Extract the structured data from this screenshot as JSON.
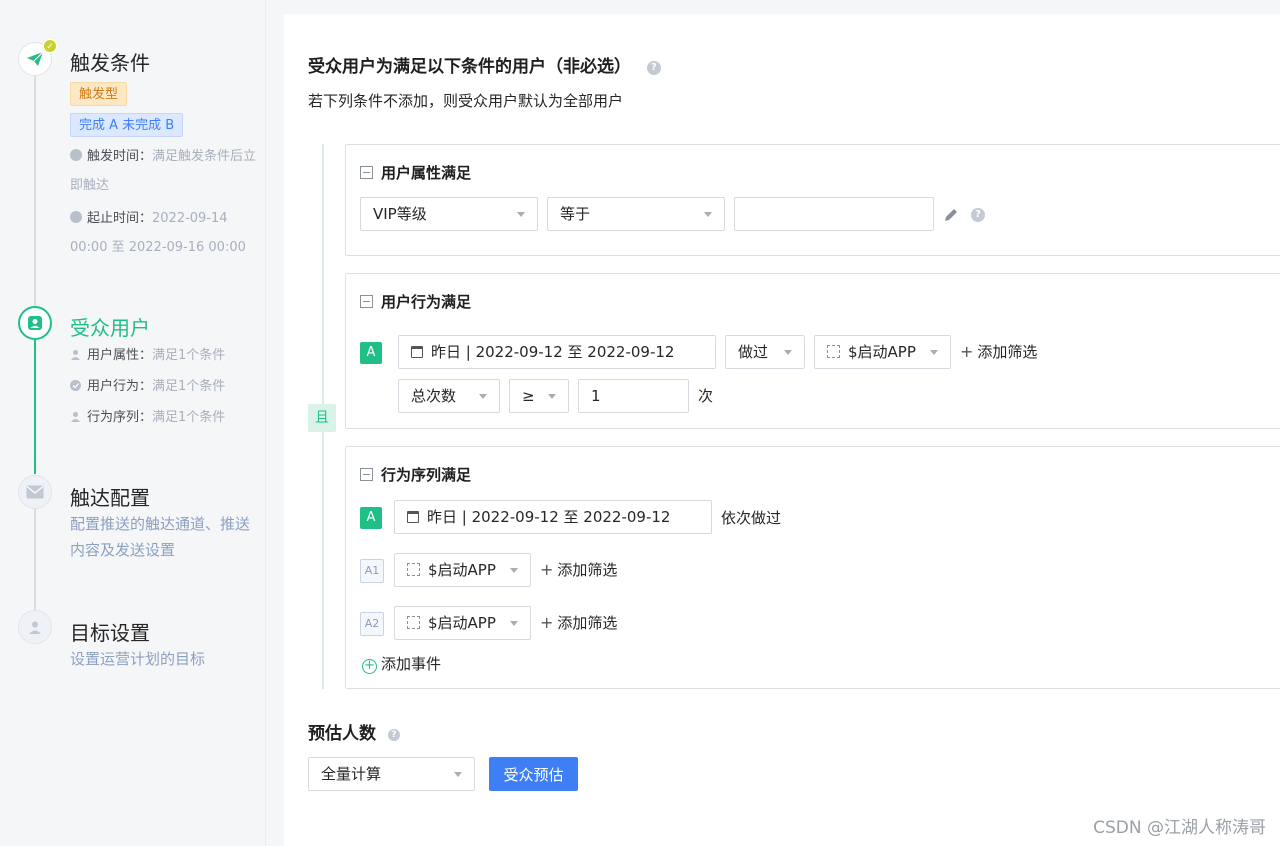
{
  "sidebar": {
    "steps": [
      {
        "title": "触发条件",
        "tags": [
          "触发型",
          "完成 A 未完成 B"
        ],
        "trigger_time_label": "触发时间：",
        "trigger_time_value": "满足触发条件后立即触达",
        "range_label": "起止时间：",
        "range_value": "2022-09-14 00:00 至 2022-09-16 00:00"
      },
      {
        "title": "受众用户",
        "items": [
          {
            "label": "用户属性：",
            "value": "满足1个条件"
          },
          {
            "label": "用户行为：",
            "value": "满足1个条件"
          },
          {
            "label": "行为序列：",
            "value": "满足1个条件"
          }
        ]
      },
      {
        "title": "触达配置",
        "desc": "配置推送的触达通道、推送内容及发送设置"
      },
      {
        "title": "目标设置",
        "desc": "设置运营计划的目标"
      }
    ]
  },
  "main": {
    "heading": "受众用户为满足以下条件的用户（非必选）",
    "subheading": "若下列条件不添加，则受众用户默认为全部用户",
    "and_label": "且",
    "attr_card": {
      "title": "用户属性满足",
      "field": "VIP等级",
      "operator": "等于",
      "value": ""
    },
    "behavior_card": {
      "title": "用户行为满足",
      "label": "A",
      "date_range": "昨日 | 2022-09-12 至 2022-09-12",
      "action": "做过",
      "event": "$启动APP",
      "add_filter": "添加筛选",
      "metric": "总次数",
      "compare": "≥",
      "count": "1",
      "unit": "次"
    },
    "sequence_card": {
      "title": "行为序列满足",
      "label": "A",
      "date_range": "昨日 | 2022-09-12 至 2022-09-12",
      "order_text": "依次做过",
      "steps": [
        {
          "label": "A1",
          "event": "$启动APP",
          "add_filter": "添加筛选"
        },
        {
          "label": "A2",
          "event": "$启动APP",
          "add_filter": "添加筛选"
        }
      ],
      "add_event": "添加事件"
    },
    "estimate": {
      "title": "预估人数",
      "mode": "全量计算",
      "button": "受众预估"
    }
  },
  "watermark": "CSDN @江湖人称涛哥",
  "colors": {
    "accent": "#1fbf85",
    "primary": "#3e7ff5",
    "tag_orange": "#cf7a12",
    "tag_blue": "#3e7ff5"
  }
}
